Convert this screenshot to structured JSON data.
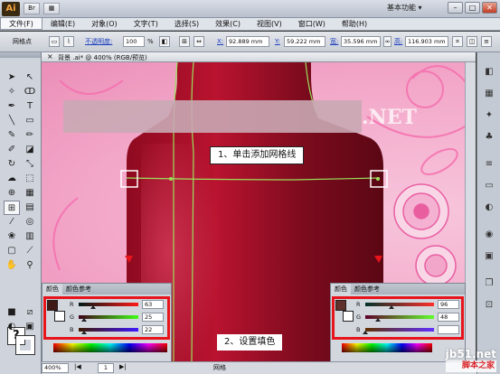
{
  "app": {
    "logo": "Ai",
    "workspace": "基本功能 ▾"
  },
  "titlebar_buttons": {
    "bridge": "Br",
    "arrange": "▦",
    "min": "–",
    "max": "□",
    "close": "✕"
  },
  "menu": [
    "文件(F)",
    "编辑(E)",
    "对象(O)",
    "文字(T)",
    "选择(S)",
    "效果(C)",
    "视图(V)",
    "窗口(W)",
    "帮助(H)"
  ],
  "controlbar": {
    "mode_label": "网格点",
    "opacity_label": "不透明度:",
    "opacity_value": "100",
    "opacity_unit": "%",
    "x_label": "X:",
    "x_value": "92.889 mm",
    "y_label": "Y:",
    "y_value": "59.222 mm",
    "w_label": "宽:",
    "w_value": "35.596 mm",
    "h_label": "高:",
    "h_value": "116.903 mm"
  },
  "document": {
    "tab_title": "背景 .ai* @ 400% (RGB/预览)",
    "close": "×"
  },
  "overlay_text": ".NET",
  "callouts": {
    "step1": "1、单击添加网格线",
    "step2": "2、设置填色"
  },
  "color_panel_left": {
    "tab_color": "颜色",
    "tab_guide": "颜色参考",
    "channels": [
      {
        "label": "R",
        "value": "63",
        "fraction": 0.247
      },
      {
        "label": "G",
        "value": "25",
        "fraction": 0.098
      },
      {
        "label": "B",
        "value": "22",
        "fraction": 0.086
      }
    ],
    "fill_hex": "#3F1916"
  },
  "color_panel_right": {
    "tab_color": "颜色",
    "tab_guide": "颜色参考",
    "channels": [
      {
        "label": "R",
        "value": "96",
        "fraction": 0.376
      },
      {
        "label": "G",
        "value": "48",
        "fraction": 0.188
      },
      {
        "label": "B",
        "value": "",
        "fraction": 0.0
      }
    ],
    "fill_hex": "#60302A"
  },
  "statusbar": {
    "zoom": "400%",
    "page": "1",
    "mode": "网格"
  },
  "watermark": {
    "site": "jb51.net",
    "name": "脚本之家"
  },
  "colors": {
    "bottle_dark": "#7c0a1e",
    "bottle_mid": "#b3112e",
    "mesh_line": "#9be05a",
    "highlight": "#e8141c"
  }
}
